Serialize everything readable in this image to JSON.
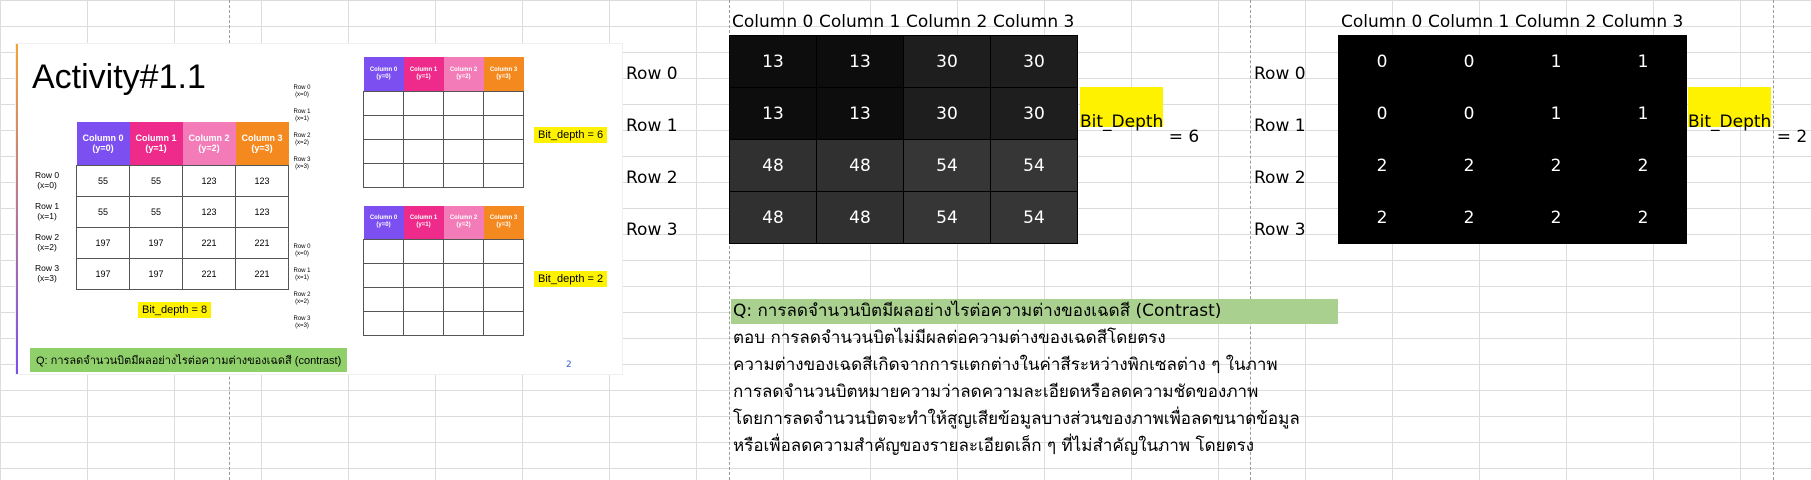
{
  "slide": {
    "title": "Activity#1.1",
    "left_table": {
      "headers": [
        {
          "name": "Column 0",
          "sub": "(y=0)"
        },
        {
          "name": "Column 1",
          "sub": "(y=1)"
        },
        {
          "name": "Column 2",
          "sub": "(y=2)"
        },
        {
          "name": "Column 3",
          "sub": "(y=3)"
        }
      ],
      "rows": [
        {
          "name": "Row 0",
          "sub": "(x=0)",
          "cells": [
            "55",
            "55",
            "123",
            "123"
          ]
        },
        {
          "name": "Row 1",
          "sub": "(x=1)",
          "cells": [
            "55",
            "55",
            "123",
            "123"
          ]
        },
        {
          "name": "Row 2",
          "sub": "(x=2)",
          "cells": [
            "197",
            "197",
            "221",
            "221"
          ]
        },
        {
          "name": "Row 3",
          "sub": "(x=3)",
          "cells": [
            "197",
            "197",
            "221",
            "221"
          ]
        }
      ],
      "badge": "Bit_depth = 8"
    },
    "empty_tables": [
      {
        "badge": "Bit_depth = 6"
      },
      {
        "badge": "Bit_depth = 2"
      }
    ],
    "question": "Q: การลดจำนวนบิตมีผลอย่างไรต่อความต่างของเฉดสี (contrast)",
    "page_number": "2"
  },
  "sheet": {
    "table1": {
      "columns": [
        "Column 0",
        "Column 1",
        "Column 2",
        "Column 3"
      ],
      "rows": [
        "Row 0",
        "Row 1",
        "Row 2",
        "Row 3"
      ],
      "values": [
        [
          "13",
          "13",
          "30",
          "30"
        ],
        [
          "13",
          "13",
          "30",
          "30"
        ],
        [
          "48",
          "48",
          "54",
          "54"
        ],
        [
          "48",
          "48",
          "54",
          "54"
        ]
      ],
      "cell_colors": [
        [
          "#0d0d0d",
          "#0d0d0d",
          "#1e1e1e",
          "#1e1e1e"
        ],
        [
          "#0d0d0d",
          "#0d0d0d",
          "#1e1e1e",
          "#1e1e1e"
        ],
        [
          "#303030",
          "#303030",
          "#363636",
          "#363636"
        ],
        [
          "#303030",
          "#303030",
          "#363636",
          "#363636"
        ]
      ],
      "bit_depth_label": "Bit_Depth",
      "bit_depth_value": " = 6"
    },
    "table2": {
      "columns": [
        "Column 0",
        "Column 1",
        "Column 2",
        "Column 3"
      ],
      "rows": [
        "Row 0",
        "Row 1",
        "Row 2",
        "Row 3"
      ],
      "values": [
        [
          "0",
          "0",
          "1",
          "1"
        ],
        [
          "0",
          "0",
          "1",
          "1"
        ],
        [
          "2",
          "2",
          "2",
          "2"
        ],
        [
          "2",
          "2",
          "2",
          "2"
        ]
      ],
      "cell_color": "#000000",
      "bit_depth_label": "Bit_Depth",
      "bit_depth_value": " = 2"
    },
    "question": "Q: การลดจำนวนบิตมีผลอย่างไรต่อความต่างของเฉดสี (Contrast)",
    "answer_lines": [
      "ตอบ การลดจำนวนบิตไม่มีผลต่อความต่างของเฉดสีโดยตรง",
      "ความต่างของเฉดสีเกิดจากการแตกต่างในค่าสีระหว่างพิกเซลต่าง ๆ ในภาพ",
      "การลดจำนวนบิตหมายความว่าลดความละเอียดหรือลดความชัดของภาพ",
      "โดยการลดจำนวนบิตจะทำให้สูญเสียข้อมูลบางส่วนของภาพเพื่อลดขนาดข้อมูล",
      "หรือเพื่อลดความสำคัญของรายละเอียดเล็ก ๆ ที่ไม่สำคัญในภาพ โดยตรง"
    ]
  }
}
